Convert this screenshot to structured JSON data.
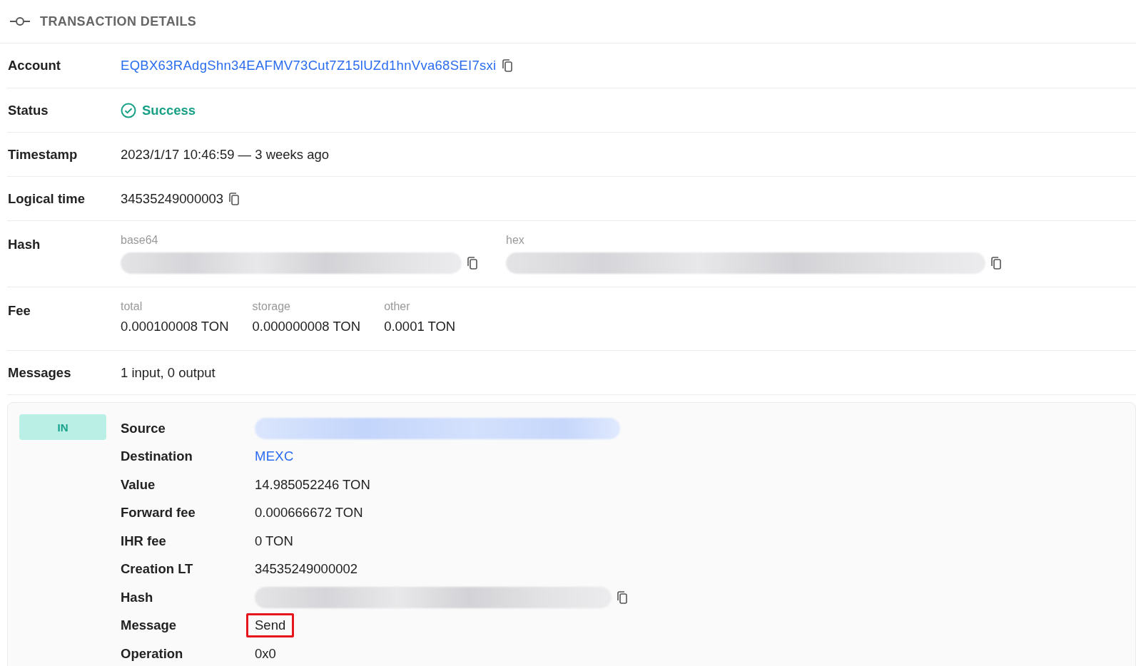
{
  "header": {
    "title": "TRANSACTION DETAILS"
  },
  "details": [
    {
      "label": "Account",
      "kind": "address",
      "value": "EQBX63RAdgShn34EAFMV73Cut7Z15lUZd1hnVva68SEI7sxi"
    },
    {
      "label": "Status",
      "kind": "status",
      "value": "Success"
    },
    {
      "label": "Timestamp",
      "kind": "text",
      "value": "2023/1/17 10:46:59 — 3 weeks ago"
    },
    {
      "label": "Logical time",
      "kind": "copyable",
      "value": "34535249000003"
    },
    {
      "label": "Hash",
      "kind": "hashes",
      "parts": [
        {
          "caption": "base64"
        },
        {
          "caption": "hex"
        }
      ]
    },
    {
      "label": "Fee",
      "kind": "fees",
      "parts": [
        {
          "caption": "total",
          "value": "0.000100008 TON"
        },
        {
          "caption": "storage",
          "value": "0.000000008 TON"
        },
        {
          "caption": "other",
          "value": "0.0001 TON"
        }
      ]
    },
    {
      "label": "Messages",
      "kind": "text",
      "value": "1 input, 0 output"
    }
  ],
  "message": {
    "direction": "IN",
    "rows": [
      {
        "label": "Source",
        "kind": "redacted-link"
      },
      {
        "label": "Destination",
        "kind": "link",
        "value": "MEXC"
      },
      {
        "label": "Value",
        "kind": "text",
        "value": "14.985052246 TON"
      },
      {
        "label": "Forward fee",
        "kind": "text",
        "value": "0.000666672 TON"
      },
      {
        "label": "IHR fee",
        "kind": "text",
        "value": "0 TON"
      },
      {
        "label": "Creation LT",
        "kind": "text",
        "value": "34535249000002"
      },
      {
        "label": "Hash",
        "kind": "redacted-copy"
      },
      {
        "label": "Message",
        "kind": "boxed",
        "value": "Send"
      },
      {
        "label": "Operation",
        "kind": "text",
        "value": "0x0"
      }
    ]
  }
}
